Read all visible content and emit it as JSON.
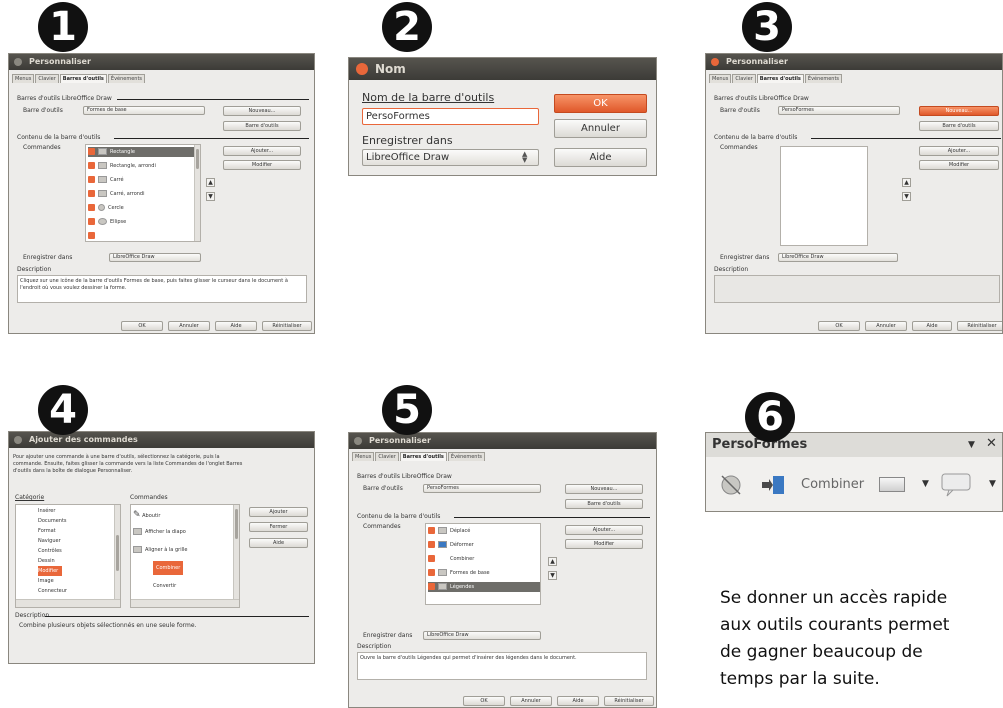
{
  "steps": [
    "1",
    "2",
    "3",
    "4",
    "5",
    "6"
  ],
  "panel1": {
    "title": "Personnaliser",
    "tabs": [
      "Menus",
      "Clavier",
      "Barres d'outils",
      "Événements"
    ],
    "section_toolbars": "Barres d'outils LibreOffice Draw",
    "toolbar_label": "Barre d'outils",
    "toolbar_value": "Formes de base",
    "new_btn": "Nouveau...",
    "toolbar_menu_btn": "Barre d'outils",
    "section_content": "Contenu de la barre d'outils",
    "commands_label": "Commandes",
    "items": [
      "Rectangle",
      "Rectangle, arrondi",
      "Carré",
      "Carré, arrondi",
      "Cercle",
      "Ellipse"
    ],
    "add_btn": "Ajouter...",
    "modify_btn": "Modifier",
    "save_in_label": "Enregistrer dans",
    "save_in_value": "LibreOffice Draw",
    "description_label": "Description",
    "description_text": "Cliquez sur une icône de la barre d'outils Formes de base, puis faites glisser le curseur dans le document à l'endroit où vous voulez dessiner la forme.",
    "ok": "OK",
    "cancel": "Annuler",
    "help": "Aide",
    "reset": "Réinitialiser"
  },
  "panel2": {
    "title": "Nom",
    "name_label": "Nom de la barre d'outils",
    "name_value": "PersoFormes",
    "save_in_label": "Enregistrer dans",
    "save_in_value": "LibreOffice Draw",
    "ok": "OK",
    "cancel": "Annuler",
    "help": "Aide"
  },
  "panel3": {
    "title": "Personnaliser",
    "tabs": [
      "Menus",
      "Clavier",
      "Barres d'outils",
      "Événements"
    ],
    "section_toolbars": "Barres d'outils LibreOffice Draw",
    "toolbar_label": "Barre d'outils",
    "toolbar_value": "PersoFormes",
    "new_btn": "Nouveau...",
    "toolbar_menu_btn": "Barre d'outils",
    "section_content": "Contenu de la barre d'outils",
    "commands_label": "Commandes",
    "add_btn": "Ajouter...",
    "modify_btn": "Modifier",
    "save_in_label": "Enregistrer dans",
    "save_in_value": "LibreOffice Draw",
    "description_label": "Description",
    "ok": "OK",
    "cancel": "Annuler",
    "help": "Aide",
    "reset": "Réinitialiser"
  },
  "panel4": {
    "title": "Ajouter des commandes",
    "intro": "Pour ajouter une commande à une barre d'outils, sélectionnez la catégorie, puis la commande. Ensuite, faites glisser la commande vers la liste Commandes de l'onglet Barres d'outils dans la boîte de dialogue Personnaliser.",
    "category_label": "Catégorie",
    "commands_label": "Commandes",
    "categories": [
      "Insérer",
      "Documents",
      "Format",
      "Naviguer",
      "Contrôles",
      "Dessin",
      "Modifier",
      "Image",
      "Connecteur"
    ],
    "commands": [
      "Aboutir",
      "Afficher la diapo",
      "Aligner à la grille",
      "Combiner",
      "Convertir"
    ],
    "add_btn": "Ajouter",
    "close_btn": "Fermer",
    "help_btn": "Aide",
    "description_label": "Description",
    "description_text": "Combine plusieurs objets sélectionnés en une seule forme."
  },
  "panel5": {
    "title": "Personnaliser",
    "tabs": [
      "Menus",
      "Clavier",
      "Barres d'outils",
      "Événements"
    ],
    "section_toolbars": "Barres d'outils LibreOffice Draw",
    "toolbar_label": "Barre d'outils",
    "toolbar_value": "PersoFormes",
    "new_btn": "Nouveau...",
    "toolbar_menu_btn": "Barre d'outils",
    "section_content": "Contenu de la barre d'outils",
    "commands_label": "Commandes",
    "items": [
      "Déplacé",
      "Déformer",
      "Combiner",
      "Formes de base",
      "Légendes"
    ],
    "add_btn": "Ajouter...",
    "modify_btn": "Modifier",
    "save_in_label": "Enregistrer dans",
    "save_in_value": "LibreOffice Draw",
    "description_label": "Description",
    "description_text": "Ouvre la barre d'outils Légendes qui permet d'insérer des légendes dans le document.",
    "ok": "OK",
    "cancel": "Annuler",
    "help": "Aide",
    "reset": "Réinitialiser"
  },
  "panel6": {
    "title": "PersoFormes",
    "combine_label": "Combiner"
  },
  "caption": {
    "line1": "Se donner un accès rapide",
    "line2": "aux outils courants permet",
    "line3": "de gagner beaucoup de",
    "line4": "temps par la suite."
  }
}
